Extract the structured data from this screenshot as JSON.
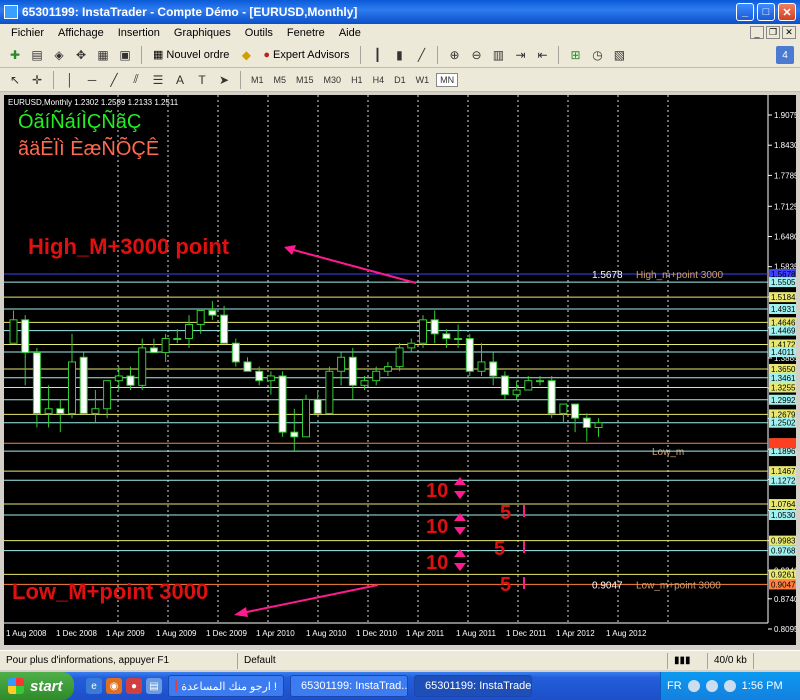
{
  "window": {
    "title": "65301199: InstaTrader - Compte Démo - [EURUSD,Monthly]"
  },
  "menu": [
    "Fichier",
    "Affichage",
    "Insertion",
    "Graphiques",
    "Outils",
    "Fenetre",
    "Aide"
  ],
  "toolbar": {
    "new_order": "Nouvel ordre",
    "expert_advisors": "Expert Advisors",
    "badge": "4"
  },
  "timeframes": [
    "M1",
    "M5",
    "M15",
    "M30",
    "H1",
    "H4",
    "D1",
    "W1",
    "MN"
  ],
  "active_timeframe": "MN",
  "chart_data": {
    "type": "candlestick",
    "header": "EURUSD,Monthly  1.2302 1.2589 1.2133 1.2511",
    "garbled_line1": "ÓãíÑáíÌÇÑãÇ",
    "garbled_line2": "ãäÊÏì ÈæÑÕÇÊ",
    "ylim": [
      0.8095,
      1.9075
    ],
    "price_ticks": [
      1.9075,
      1.843,
      1.7785,
      1.7125,
      1.648,
      1.5835,
      1.519,
      1.453,
      1.3885,
      1.324,
      1.2595,
      1.1935,
      1.129,
      1.063,
      0.9985,
      0.934,
      0.874,
      0.8095
    ],
    "x_labels": [
      "1 Aug 2008",
      "1 Dec 2008",
      "1 Apr 2009",
      "1 Aug 2009",
      "1 Dec 2009",
      "1 Apr 2010",
      "1 Aug 2010",
      "1 Dec 2010",
      "1 Apr 2011",
      "1 Aug 2011",
      "1 Dec 2011",
      "1 Apr 2012",
      "1 Aug 2012"
    ],
    "candles": [
      {
        "o": 1.42,
        "h": 1.49,
        "l": 1.42,
        "c": 1.47
      },
      {
        "o": 1.47,
        "h": 1.48,
        "l": 1.33,
        "c": 1.4
      },
      {
        "o": 1.4,
        "h": 1.41,
        "l": 1.24,
        "c": 1.27
      },
      {
        "o": 1.27,
        "h": 1.33,
        "l": 1.24,
        "c": 1.28
      },
      {
        "o": 1.28,
        "h": 1.3,
        "l": 1.23,
        "c": 1.27
      },
      {
        "o": 1.27,
        "h": 1.44,
        "l": 1.26,
        "c": 1.38
      },
      {
        "o": 1.39,
        "h": 1.4,
        "l": 1.27,
        "c": 1.27
      },
      {
        "o": 1.27,
        "h": 1.32,
        "l": 1.25,
        "c": 1.28
      },
      {
        "o": 1.28,
        "h": 1.34,
        "l": 1.26,
        "c": 1.34
      },
      {
        "o": 1.34,
        "h": 1.37,
        "l": 1.32,
        "c": 1.35
      },
      {
        "o": 1.35,
        "h": 1.37,
        "l": 1.32,
        "c": 1.33
      },
      {
        "o": 1.33,
        "h": 1.43,
        "l": 1.32,
        "c": 1.41
      },
      {
        "o": 1.41,
        "h": 1.43,
        "l": 1.4,
        "c": 1.4
      },
      {
        "o": 1.4,
        "h": 1.44,
        "l": 1.38,
        "c": 1.43
      },
      {
        "o": 1.43,
        "h": 1.45,
        "l": 1.42,
        "c": 1.43
      },
      {
        "o": 1.43,
        "h": 1.48,
        "l": 1.41,
        "c": 1.46
      },
      {
        "o": 1.46,
        "h": 1.49,
        "l": 1.44,
        "c": 1.49
      },
      {
        "o": 1.49,
        "h": 1.51,
        "l": 1.47,
        "c": 1.48
      },
      {
        "o": 1.48,
        "h": 1.5,
        "l": 1.42,
        "c": 1.42
      },
      {
        "o": 1.42,
        "h": 1.43,
        "l": 1.37,
        "c": 1.38
      },
      {
        "o": 1.38,
        "h": 1.39,
        "l": 1.36,
        "c": 1.36
      },
      {
        "o": 1.36,
        "h": 1.37,
        "l": 1.33,
        "c": 1.34
      },
      {
        "o": 1.34,
        "h": 1.36,
        "l": 1.31,
        "c": 1.35
      },
      {
        "o": 1.35,
        "h": 1.36,
        "l": 1.22,
        "c": 1.23
      },
      {
        "o": 1.23,
        "h": 1.28,
        "l": 1.19,
        "c": 1.22
      },
      {
        "o": 1.22,
        "h": 1.31,
        "l": 1.22,
        "c": 1.3
      },
      {
        "o": 1.3,
        "h": 1.32,
        "l": 1.27,
        "c": 1.27
      },
      {
        "o": 1.27,
        "h": 1.37,
        "l": 1.27,
        "c": 1.36
      },
      {
        "o": 1.36,
        "h": 1.4,
        "l": 1.33,
        "c": 1.39
      },
      {
        "o": 1.39,
        "h": 1.41,
        "l": 1.3,
        "c": 1.33
      },
      {
        "o": 1.33,
        "h": 1.35,
        "l": 1.32,
        "c": 1.34
      },
      {
        "o": 1.34,
        "h": 1.37,
        "l": 1.33,
        "c": 1.36
      },
      {
        "o": 1.36,
        "h": 1.38,
        "l": 1.35,
        "c": 1.37
      },
      {
        "o": 1.37,
        "h": 1.42,
        "l": 1.36,
        "c": 1.41
      },
      {
        "o": 1.41,
        "h": 1.43,
        "l": 1.4,
        "c": 1.42
      },
      {
        "o": 1.42,
        "h": 1.48,
        "l": 1.41,
        "c": 1.47
      },
      {
        "o": 1.47,
        "h": 1.49,
        "l": 1.42,
        "c": 1.44
      },
      {
        "o": 1.44,
        "h": 1.45,
        "l": 1.41,
        "c": 1.43
      },
      {
        "o": 1.43,
        "h": 1.46,
        "l": 1.41,
        "c": 1.43
      },
      {
        "o": 1.43,
        "h": 1.44,
        "l": 1.35,
        "c": 1.36
      },
      {
        "o": 1.36,
        "h": 1.42,
        "l": 1.35,
        "c": 1.38
      },
      {
        "o": 1.38,
        "h": 1.4,
        "l": 1.33,
        "c": 1.35
      },
      {
        "o": 1.35,
        "h": 1.36,
        "l": 1.3,
        "c": 1.31
      },
      {
        "o": 1.31,
        "h": 1.34,
        "l": 1.3,
        "c": 1.32
      },
      {
        "o": 1.32,
        "h": 1.35,
        "l": 1.32,
        "c": 1.34
      },
      {
        "o": 1.34,
        "h": 1.35,
        "l": 1.33,
        "c": 1.34
      },
      {
        "o": 1.34,
        "h": 1.35,
        "l": 1.26,
        "c": 1.27
      },
      {
        "o": 1.27,
        "h": 1.29,
        "l": 1.25,
        "c": 1.29
      },
      {
        "o": 1.29,
        "h": 1.29,
        "l": 1.23,
        "c": 1.26
      },
      {
        "o": 1.26,
        "h": 1.27,
        "l": 1.21,
        "c": 1.24
      },
      {
        "o": 1.24,
        "h": 1.26,
        "l": 1.22,
        "c": 1.25
      }
    ],
    "levels": [
      {
        "price": 1.5678,
        "label": "1.5678",
        "color": "#4040ff",
        "tag": "High_m+point 3000",
        "tag_color": "#d2a070"
      },
      {
        "price": 1.5505,
        "label": "1.5505",
        "color": "#a0f0f0"
      },
      {
        "price": 1.5184,
        "label": "1.5184",
        "color": "#e8e870"
      },
      {
        "price": 1.4931,
        "label": "1.4931",
        "color": "#a0f0f0"
      },
      {
        "price": 1.4646,
        "label": "1.4646",
        "color": "#e8e870"
      },
      {
        "price": 1.4469,
        "label": "1.4469",
        "color": "#a0f0f0"
      },
      {
        "price": 1.4172,
        "label": "1.4172",
        "color": "#e8e870"
      },
      {
        "price": 1.4011,
        "label": "1.4011",
        "color": "#a0f0f0"
      },
      {
        "price": 1.365,
        "label": "1.3650",
        "color": "#e8e870"
      },
      {
        "price": 1.3461,
        "label": "1.3461",
        "color": "#a0f0f0"
      },
      {
        "price": 1.3255,
        "label": "1.3255",
        "color": "#e8e870"
      },
      {
        "price": 1.2992,
        "label": "1.2992",
        "color": "#a0f0f0"
      },
      {
        "price": 1.2679,
        "label": "1.2679",
        "color": "#e8e870"
      },
      {
        "price": 1.2502,
        "label": "1.2502",
        "color": "#a0f0f0"
      },
      {
        "price": 1.2063,
        "label": "1.2063",
        "color": "#ff8040",
        "tag": "Low_m",
        "tag_color": "#d2a070"
      },
      {
        "price": 1.1896,
        "label": "1.1896",
        "color": "#a0f0f0"
      },
      {
        "price": 1.1467,
        "label": "1.1467",
        "color": "#e8e870"
      },
      {
        "price": 1.1272,
        "label": "1.1272",
        "color": "#a0f0f0"
      },
      {
        "price": 1.0764,
        "label": "1.0764",
        "color": "#e8e870"
      },
      {
        "price": 1.053,
        "label": "1.0530",
        "color": "#a0f0f0"
      },
      {
        "price": 0.9983,
        "label": "0.9983",
        "color": "#e8e870"
      },
      {
        "price": 0.9768,
        "label": "0.9768",
        "color": "#a0f0f0"
      },
      {
        "price": 0.9261,
        "label": "0.9261",
        "color": "#e8e870"
      },
      {
        "price": 0.9047,
        "label": "0.9047",
        "color": "#ff8040",
        "tag": "Low_m+point 3000",
        "tag_color": "#d2a070"
      }
    ],
    "level_value_texts": [
      {
        "price": 1.5678,
        "text": "1.5678"
      },
      {
        "price": 0.9047,
        "text": "0.9047"
      }
    ],
    "current_price": "1.2511",
    "annotations": {
      "high": "High_M+3000 point",
      "low": "Low_M+point 3000",
      "ten": "10",
      "five": "5"
    }
  },
  "status": {
    "help": "Pour plus d'informations, appuyer F1",
    "profile": "Default",
    "traffic": "40/0 kb"
  },
  "taskbar": {
    "start": "start",
    "tasks": [
      "ارجو منك المساعدة !",
      "65301199: InstaTrad...",
      "65301199: InstaTrade..."
    ],
    "lang": "FR",
    "clock": "1:56 PM"
  }
}
